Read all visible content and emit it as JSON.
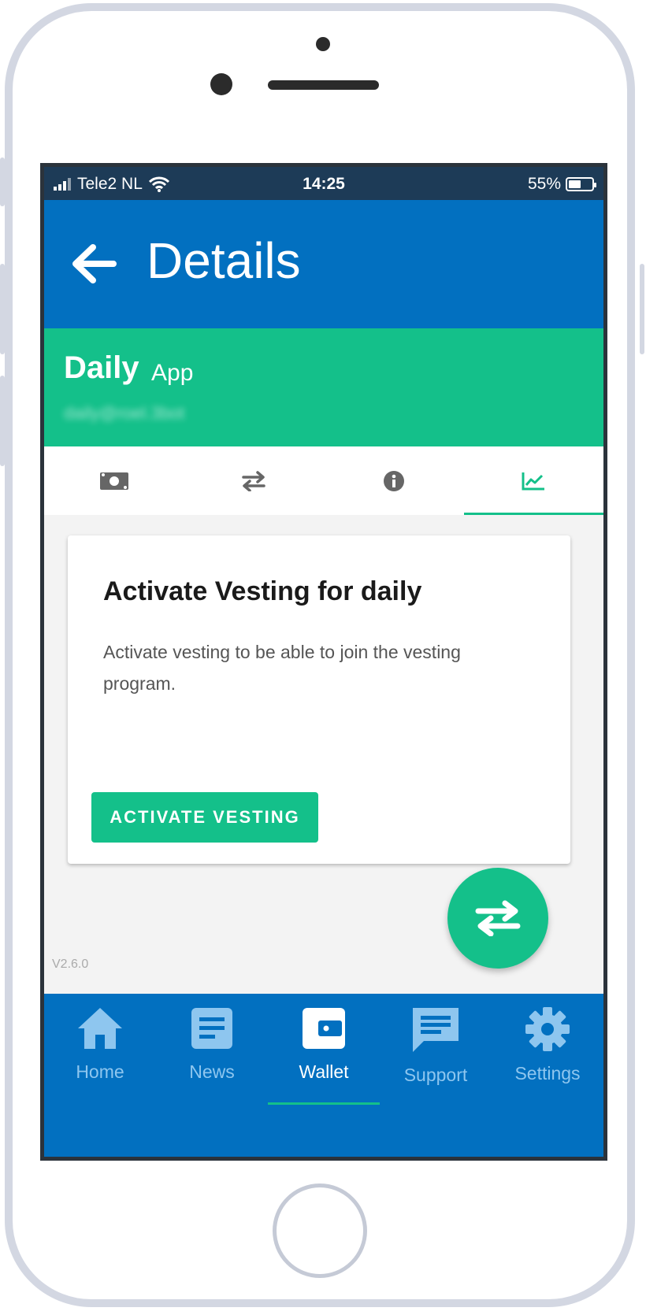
{
  "status_bar": {
    "carrier": "Tele2 NL",
    "time": "14:25",
    "battery": "55%",
    "battery_level": 0.55
  },
  "app_bar": {
    "title": "Details",
    "back_icon": "arrow-left-icon"
  },
  "account": {
    "name": "Daily",
    "type": "App",
    "email": "daily@roel.3bot"
  },
  "tabs": [
    {
      "icon": "money-icon",
      "active": false
    },
    {
      "icon": "transfer-icon",
      "active": false
    },
    {
      "icon": "info-icon",
      "active": false
    },
    {
      "icon": "chart-icon",
      "active": true
    }
  ],
  "card": {
    "heading": "Activate Vesting for daily",
    "body": "Activate vesting to be able to join the vesting program.",
    "button": "ACTIVATE VESTING"
  },
  "fab": {
    "icon": "transfer-icon"
  },
  "version": "V2.6.0",
  "bottom_nav": [
    {
      "label": "Home",
      "icon": "home-icon",
      "active": false
    },
    {
      "label": "News",
      "icon": "news-icon",
      "active": false
    },
    {
      "label": "Wallet",
      "icon": "wallet-icon",
      "active": true
    },
    {
      "label": "Support",
      "icon": "chat-icon",
      "active": false
    },
    {
      "label": "Settings",
      "icon": "gear-icon",
      "active": false
    }
  ],
  "colors": {
    "primary": "#0270c0",
    "accent": "#14c08a",
    "status_bar": "#1d3b57"
  }
}
